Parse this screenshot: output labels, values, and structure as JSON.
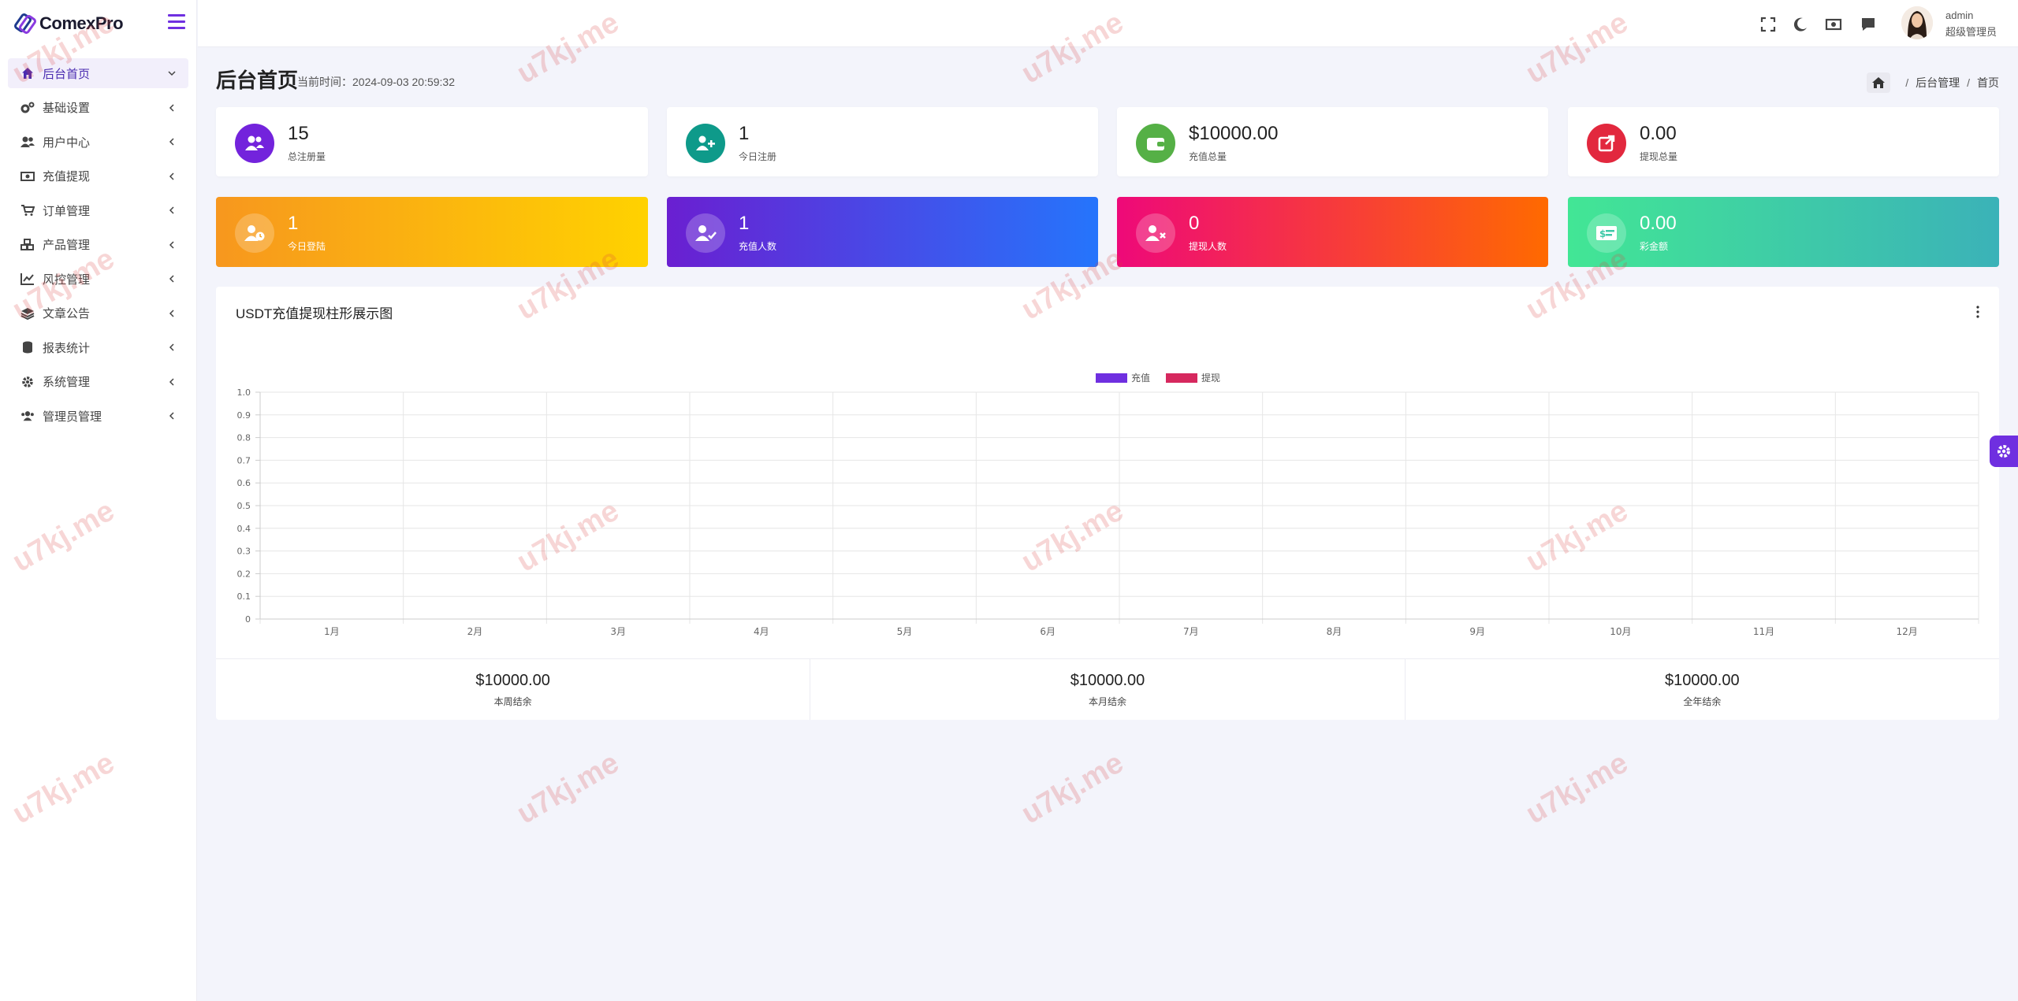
{
  "brand": {
    "name": "ComexPro"
  },
  "sidebar": {
    "items": [
      {
        "label": "后台首页",
        "icon": "home-icon",
        "active": true
      },
      {
        "label": "基础设置",
        "icon": "cogs-icon"
      },
      {
        "label": "用户中心",
        "icon": "users-icon"
      },
      {
        "label": "充值提现",
        "icon": "money-icon"
      },
      {
        "label": "订单管理",
        "icon": "cart-icon"
      },
      {
        "label": "产品管理",
        "icon": "cubes-icon"
      },
      {
        "label": "风控管理",
        "icon": "chart-line-icon"
      },
      {
        "label": "文章公告",
        "icon": "layers-icon"
      },
      {
        "label": "报表统计",
        "icon": "database-icon"
      },
      {
        "label": "系统管理",
        "icon": "gear-icon"
      },
      {
        "label": "管理员管理",
        "icon": "user-group-icon"
      }
    ]
  },
  "topbar": {
    "icons": [
      "fullscreen-icon",
      "moon-icon",
      "money-icon",
      "message-icon"
    ],
    "user": {
      "name": "admin",
      "role": "超级管理员"
    }
  },
  "header": {
    "title": "后台首页",
    "time": "当前时间：2024-09-03 20:59:32",
    "breadcrumb": [
      "后台管理",
      "首页"
    ]
  },
  "stats": [
    {
      "value": "15",
      "label": "总注册量",
      "color": "#7323dc",
      "icon": "users-icon"
    },
    {
      "value": "1",
      "label": "今日注册",
      "color": "#0e9a8a",
      "icon": "user-plus-icon"
    },
    {
      "value": "$10000.00",
      "label": "充值总量",
      "color": "#55b046",
      "icon": "wallet-icon"
    },
    {
      "value": "0.00",
      "label": "提现总量",
      "color": "#e2283e",
      "icon": "external-link-icon"
    }
  ],
  "gradient_stats": [
    {
      "value": "1",
      "label": "今日登陆",
      "from": "#f7971e",
      "to": "#ffd200",
      "icon": "user-clock-icon"
    },
    {
      "value": "1",
      "label": "充值人数",
      "from": "#6a1fd1",
      "to": "#2575fc",
      "icon": "user-check-icon"
    },
    {
      "value": "0",
      "label": "提现人数",
      "from": "#ee0979",
      "to": "#ff6a00",
      "icon": "user-times-icon"
    },
    {
      "value": "0.00",
      "label": "彩金额",
      "from": "#42e695",
      "to": "#3bb2b8",
      "icon": "money-card-icon"
    }
  ],
  "chart_data": {
    "type": "bar",
    "title": "USDT充值提现柱形展示图",
    "categories": [
      "1月",
      "2月",
      "3月",
      "4月",
      "5月",
      "6月",
      "7月",
      "8月",
      "9月",
      "10月",
      "11月",
      "12月"
    ],
    "series": [
      {
        "name": "充值",
        "color": "#6f2fe0",
        "values": [
          0,
          0,
          0,
          0,
          0,
          0,
          0,
          0,
          0,
          0,
          0,
          0
        ]
      },
      {
        "name": "提现",
        "color": "#d6285e",
        "values": [
          0,
          0,
          0,
          0,
          0,
          0,
          0,
          0,
          0,
          0,
          0,
          0
        ]
      }
    ],
    "yticks": [
      "0",
      "0.1",
      "0.2",
      "0.3",
      "0.4",
      "0.5",
      "0.6",
      "0.7",
      "0.8",
      "0.9",
      "1.0"
    ],
    "ylim": [
      0,
      1
    ],
    "grid": true,
    "legend": "top-center"
  },
  "summary": [
    {
      "value": "$10000.00",
      "label": "本周结余"
    },
    {
      "value": "$10000.00",
      "label": "本月结余"
    },
    {
      "value": "$10000.00",
      "label": "全年结余"
    }
  ],
  "watermark": "u7kj.me"
}
